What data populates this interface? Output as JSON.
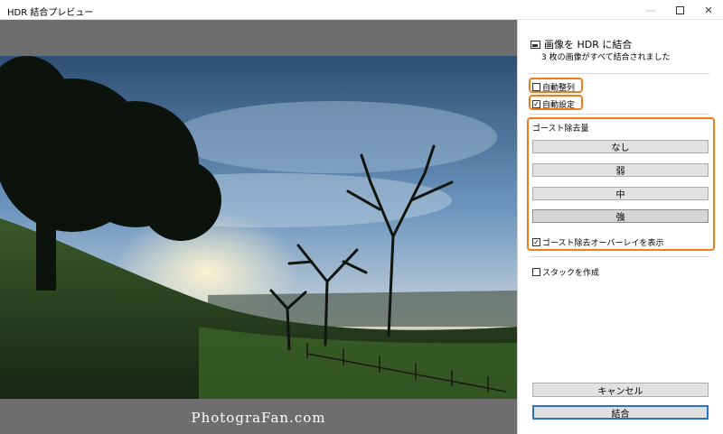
{
  "window": {
    "title": "HDR 結合プレビュー",
    "min_icon": "—",
    "close_icon": "✕"
  },
  "preview": {
    "watermark": "PhotograFan.com"
  },
  "panel": {
    "header": "画像を HDR に結合",
    "subtext": "3 枚の画像がすべて結合されました",
    "auto_align": {
      "label": "自動整列",
      "checked": false
    },
    "auto_settings": {
      "label": "自動設定",
      "checked": true
    },
    "deghost": {
      "label": "ゴースト除去量",
      "options": [
        "なし",
        "弱",
        "中",
        "強"
      ],
      "selected": "強"
    },
    "overlay": {
      "label": "ゴースト除去オーバーレイを表示",
      "checked": true
    },
    "stack": {
      "label": "スタックを作成",
      "checked": false
    },
    "cancel_label": "キャンセル",
    "merge_label": "結合"
  },
  "colors": {
    "highlight": "#f07c1d",
    "primary_border": "#2a74c6"
  }
}
